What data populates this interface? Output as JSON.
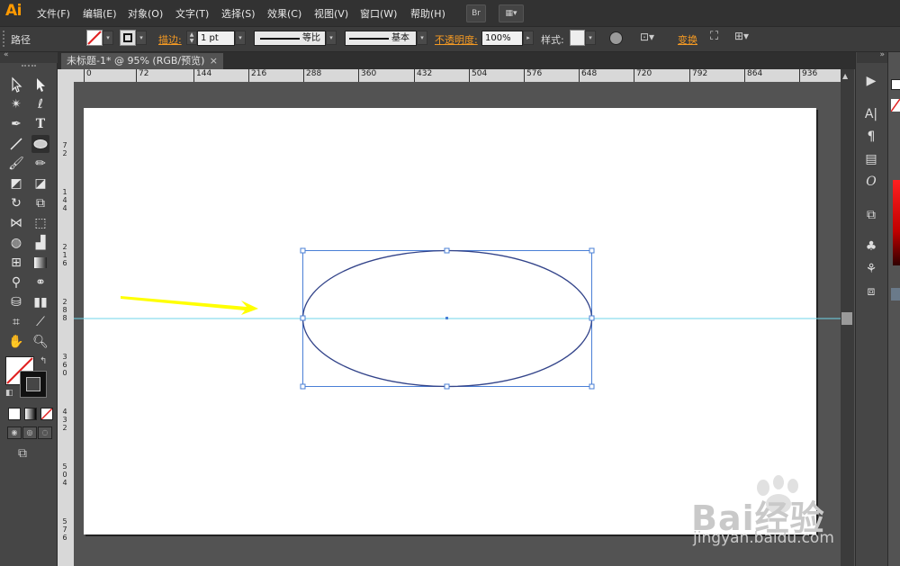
{
  "app": {
    "logo": "Ai"
  },
  "menu": [
    "文件(F)",
    "编辑(E)",
    "对象(O)",
    "文字(T)",
    "选择(S)",
    "效果(C)",
    "视图(V)",
    "窗口(W)",
    "帮助(H)"
  ],
  "menu_buttons": {
    "bridge": "Br"
  },
  "control_bar": {
    "selection_label": "路径",
    "stroke_label": "描边:",
    "stroke_weight": "1 pt",
    "profile_label": "等比",
    "brush_label": "基本",
    "opacity_label": "不透明度:",
    "opacity_value": "100%",
    "style_label": "样式:",
    "transform_label": "变换"
  },
  "document": {
    "tab_title": "未标题-1* @ 95% (RGB/预览)",
    "close_glyph": "×"
  },
  "ruler_h": [
    "0",
    "72",
    "144",
    "216",
    "288",
    "360",
    "432",
    "504",
    "576",
    "648",
    "720",
    "792",
    "864",
    "936"
  ],
  "ruler_v": [
    "7 2",
    "1 4 4",
    "2 1 6",
    "2 8 8",
    "3 6 0",
    "4 3 2",
    "5 0 4",
    "5 7 6"
  ],
  "colors": {
    "menubar": "#323232",
    "guide": "#6fd6e8",
    "selection": "#4a7fd6",
    "arrow": "#ffff00",
    "ai_orange": "#ff9a00"
  },
  "icons": {
    "selection": "selection-tool-icon",
    "ellipse": "ellipse-tool-icon",
    "type": "type-tool-icon",
    "hand": "hand-tool-icon",
    "zoom": "zoom-tool-icon"
  },
  "watermark": {
    "brand": "Bai经验",
    "url": "jingyan.baidu.com"
  }
}
